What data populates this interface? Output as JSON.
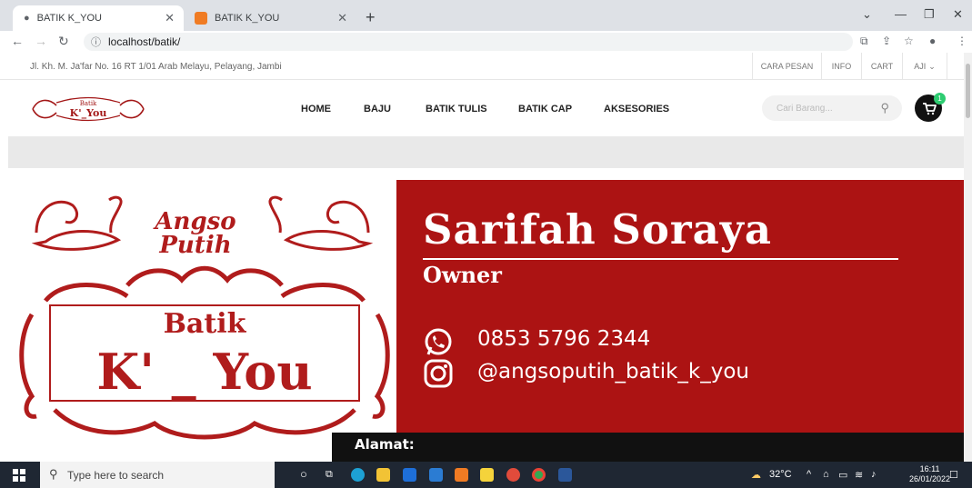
{
  "browser": {
    "tabs": [
      {
        "title": "BATIK K_YOU",
        "active": true
      },
      {
        "title": "BATIK K_YOU",
        "active": false
      }
    ],
    "url": "localhost/batik/",
    "new_tab_label": "+"
  },
  "site": {
    "address": "Jl. Kh. M. Ja'far No. 16 RT 1/01 Arab Melayu, Pelayang, Jambi",
    "top_links": [
      "CARA PESAN",
      "INFO",
      "CART",
      "AJI"
    ],
    "logo": {
      "line1": "Batik",
      "line2": "K'_You"
    },
    "menu": [
      "HOME",
      "BAJU",
      "BATIK TULIS",
      "BATIK CAP",
      "AKSESORIES"
    ],
    "search_placeholder": "Cari Barang...",
    "cart_count": "1"
  },
  "banner": {
    "brand_line1": "Angso",
    "brand_line2": "Putih",
    "batik_word": "Batik",
    "kyou": "K' _ You",
    "name": "Sarifah Soraya",
    "role": "Owner",
    "phone": "0853 5796 2344",
    "instagram": "@angsoputih_batik_k_you",
    "address_label": "Alamat:"
  },
  "taskbar": {
    "search_placeholder": "Type here to search",
    "weather": "32°C",
    "time": "16:11",
    "date": "26/01/2022"
  },
  "colors": {
    "brand_red": "#ac1313",
    "cart_badge": "#2ecc71"
  }
}
